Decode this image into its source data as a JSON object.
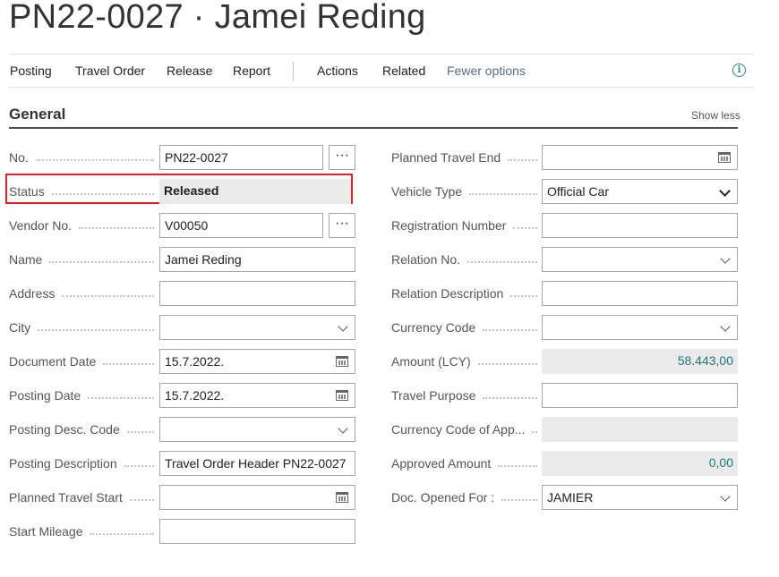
{
  "page": {
    "title": "PN22-0027 · Jamei Reding"
  },
  "actions": [
    {
      "label": "Posting"
    },
    {
      "label": "Travel Order"
    },
    {
      "label": "Release"
    },
    {
      "label": "Report"
    },
    {
      "label": "Actions"
    },
    {
      "label": "Related"
    },
    {
      "label": "Fewer options"
    }
  ],
  "section": {
    "title": "General",
    "show_less": "Show less"
  },
  "left_fields": [
    {
      "label": "No.",
      "value": "PN22-0027",
      "control": "assist"
    },
    {
      "label": "Status",
      "value": "Released",
      "control": "readonly",
      "highlighted": true
    },
    {
      "label": "Vendor No.",
      "value": "V00050",
      "control": "assist"
    },
    {
      "label": "Name",
      "value": "Jamei Reding",
      "control": "text"
    },
    {
      "label": "Address",
      "value": "",
      "control": "text"
    },
    {
      "label": "City",
      "value": "",
      "control": "dropdown"
    },
    {
      "label": "Document Date",
      "value": "15.7.2022.",
      "control": "date"
    },
    {
      "label": "Posting Date",
      "value": "15.7.2022.",
      "control": "date"
    },
    {
      "label": "Posting Desc. Code",
      "value": "",
      "control": "dropdown"
    },
    {
      "label": "Posting Description",
      "value": "Travel Order Header PN22-0027",
      "control": "text"
    },
    {
      "label": "Planned Travel Start",
      "value": "",
      "control": "date"
    },
    {
      "label": "Start Mileage",
      "value": "",
      "control": "text"
    }
  ],
  "right_fields": [
    {
      "label": "Planned Travel End",
      "value": "",
      "control": "date"
    },
    {
      "label": "Vehicle Type",
      "value": "Official Car",
      "control": "select"
    },
    {
      "label": "Registration Number",
      "value": "",
      "control": "text"
    },
    {
      "label": "Relation No.",
      "value": "",
      "control": "dropdown"
    },
    {
      "label": "Relation Description",
      "value": "",
      "control": "text"
    },
    {
      "label": "Currency Code",
      "value": "",
      "control": "dropdown"
    },
    {
      "label": "Amount (LCY)",
      "value": "58.443,00",
      "control": "readonly-amount"
    },
    {
      "label": "Travel Purpose",
      "value": "",
      "control": "text"
    },
    {
      "label": "Currency Code of App...",
      "value": "",
      "control": "readonly"
    },
    {
      "label": "Approved Amount",
      "value": "0,00",
      "control": "readonly-amount"
    },
    {
      "label": "Doc. Opened For :",
      "value": "JAMIER",
      "control": "dropdown"
    }
  ],
  "icons": {
    "info": "info-icon",
    "calendar": "calendar-icon",
    "dropdown": "chevron-down-icon",
    "assist": "ellipsis-icon"
  },
  "colors": {
    "highlight": "#e0262b",
    "link_value": "#1f7a7a",
    "section_underline": "#444c5c"
  }
}
